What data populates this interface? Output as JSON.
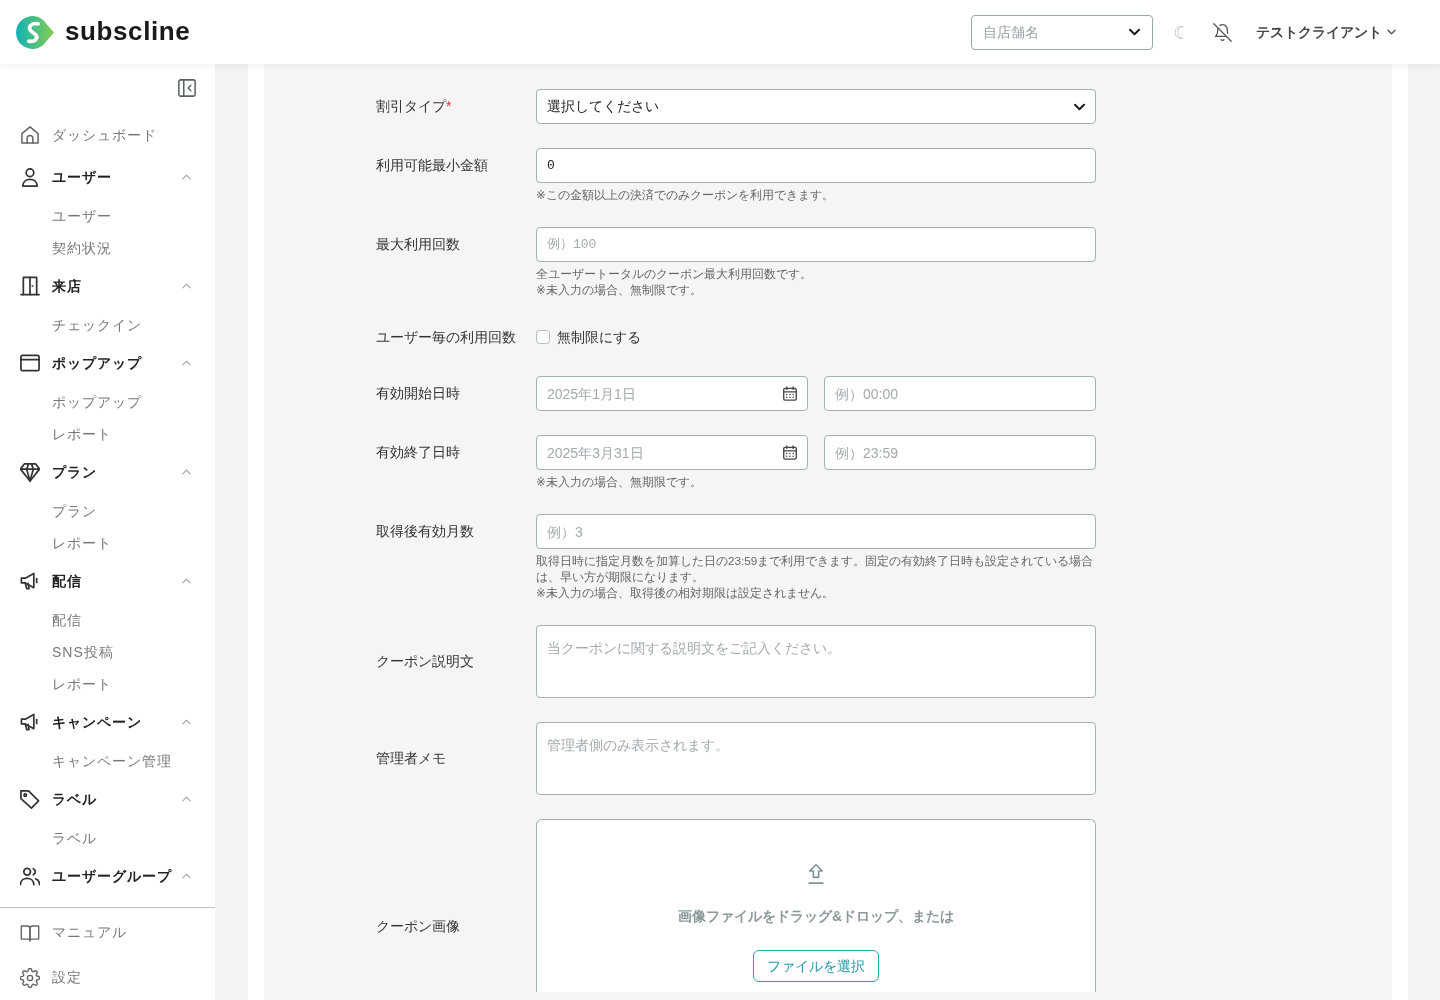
{
  "header": {
    "logo_text": "subscline",
    "store_select": {
      "placeholder": "自店舗名"
    },
    "user_menu": {
      "label": "テストクライアント"
    }
  },
  "sidebar": {
    "items": [
      {
        "kind": "link",
        "label": "ダッシュボード"
      },
      {
        "kind": "group",
        "label": "ユーザー",
        "expanded": true,
        "children": [
          {
            "label": "ユーザー"
          },
          {
            "label": "契約状況"
          }
        ]
      },
      {
        "kind": "group",
        "label": "来店",
        "expanded": true,
        "children": [
          {
            "label": "チェックイン"
          }
        ]
      },
      {
        "kind": "group",
        "label": "ポップアップ",
        "expanded": true,
        "children": [
          {
            "label": "ポップアップ"
          },
          {
            "label": "レポート"
          }
        ]
      },
      {
        "kind": "group",
        "label": "プラン",
        "expanded": true,
        "children": [
          {
            "label": "プラン"
          },
          {
            "label": "レポート"
          }
        ]
      },
      {
        "kind": "group",
        "label": "配信",
        "expanded": true,
        "children": [
          {
            "label": "配信"
          },
          {
            "label": "SNS投稿"
          },
          {
            "label": "レポート"
          }
        ]
      },
      {
        "kind": "group",
        "label": "キャンペーン",
        "expanded": true,
        "children": [
          {
            "label": "キャンペーン管理"
          }
        ]
      },
      {
        "kind": "group",
        "label": "ラベル",
        "expanded": true,
        "children": [
          {
            "label": "ラベル"
          }
        ]
      },
      {
        "kind": "group",
        "label": "ユーザーグループ",
        "expanded": true
      }
    ],
    "footer": [
      {
        "label": "マニュアル"
      },
      {
        "label": "設定"
      }
    ]
  },
  "form": {
    "fields": [
      {
        "kind": "select",
        "label": "割引タイプ",
        "required_mark": "*",
        "placeholder": "選択してください"
      },
      {
        "kind": "number",
        "label": "利用可能最小金額",
        "value": "0",
        "help": [
          "※この金額以上の決済でのみクーポンを利用できます。"
        ]
      },
      {
        "kind": "number",
        "label": "最大利用回数",
        "placeholder": "例）100",
        "help": [
          "全ユーザートータルのクーポン最大利用回数です。",
          "※未入力の場合、無制限です。"
        ]
      },
      {
        "kind": "checkbox",
        "label": "ユーザー毎の利用回数",
        "option": "無制限にする",
        "checked": false
      },
      {
        "kind": "datetime",
        "label": "有効開始日時",
        "date": {
          "placeholder": "2025年1月1日"
        },
        "time": {
          "placeholder": "例）00:00"
        }
      },
      {
        "kind": "datetime",
        "label": "有効終了日時",
        "date": {
          "placeholder": "2025年3月31日"
        },
        "time": {
          "placeholder": "例）23:59"
        },
        "help": [
          "※未入力の場合、無期限です。"
        ]
      },
      {
        "kind": "text",
        "label": "取得後有効月数",
        "placeholder": "例）3",
        "help": [
          "取得日時に指定月数を加算した日の23:59まで利用できます。固定の有効終了日時も設定されている場合は、早い方が期限になります。",
          "※未入力の場合、取得後の相対期限は設定されません。"
        ]
      },
      {
        "kind": "textarea",
        "label": "クーポン説明文",
        "placeholder": "当クーポンに関する説明文をご記入ください。"
      },
      {
        "kind": "textarea",
        "label": "管理者メモ",
        "placeholder": "管理者側のみ表示されます。"
      },
      {
        "kind": "image",
        "label": "クーポン画像",
        "drop_text": "画像ファイルをドラッグ&ドロップ、または",
        "button": "ファイルを選択"
      }
    ]
  }
}
